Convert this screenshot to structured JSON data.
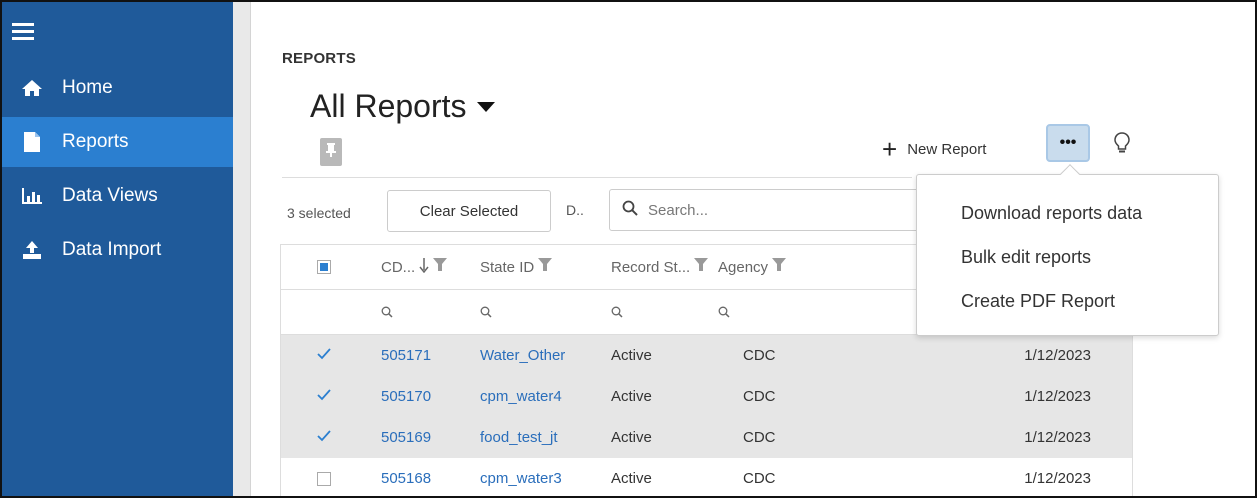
{
  "sidebar": {
    "menu_icon": "hamburger-icon",
    "items": [
      {
        "label": "Home",
        "icon": "home-icon",
        "active": false
      },
      {
        "label": "Reports",
        "icon": "document-icon",
        "active": true
      },
      {
        "label": "Data Views",
        "icon": "bar-chart-icon",
        "active": false
      },
      {
        "label": "Data Import",
        "icon": "upload-icon",
        "active": false
      }
    ]
  },
  "header": {
    "breadcrumb": "REPORTS",
    "title": "All Reports",
    "new_report_label": "New Report",
    "more_label": "•••"
  },
  "toolbar": {
    "selected_count": "3 selected",
    "clear_label": "Clear Selected",
    "d_label": "D..",
    "search_placeholder": "Search..."
  },
  "table": {
    "columns": [
      "CD...",
      "State ID",
      "Record St...",
      "Agency"
    ],
    "rows": [
      {
        "checked": true,
        "cd": "505171",
        "state_id": "Water_Other",
        "status": "Active",
        "agency": "CDC",
        "date": "1/12/2023"
      },
      {
        "checked": true,
        "cd": "505170",
        "state_id": "cpm_water4",
        "status": "Active",
        "agency": "CDC",
        "date": "1/12/2023"
      },
      {
        "checked": true,
        "cd": "505169",
        "state_id": "food_test_jt",
        "status": "Active",
        "agency": "CDC",
        "date": "1/12/2023"
      },
      {
        "checked": false,
        "cd": "505168",
        "state_id": "cpm_water3",
        "status": "Active",
        "agency": "CDC",
        "date": "1/12/2023"
      }
    ]
  },
  "menu": {
    "items": [
      "Download reports data",
      "Bulk edit reports",
      "Create PDF Report"
    ]
  },
  "colors": {
    "sidebar_bg": "#1f5a9a",
    "sidebar_active": "#2b7fd0",
    "link": "#2a6ebb",
    "selected_row": "#e6e6e6"
  }
}
